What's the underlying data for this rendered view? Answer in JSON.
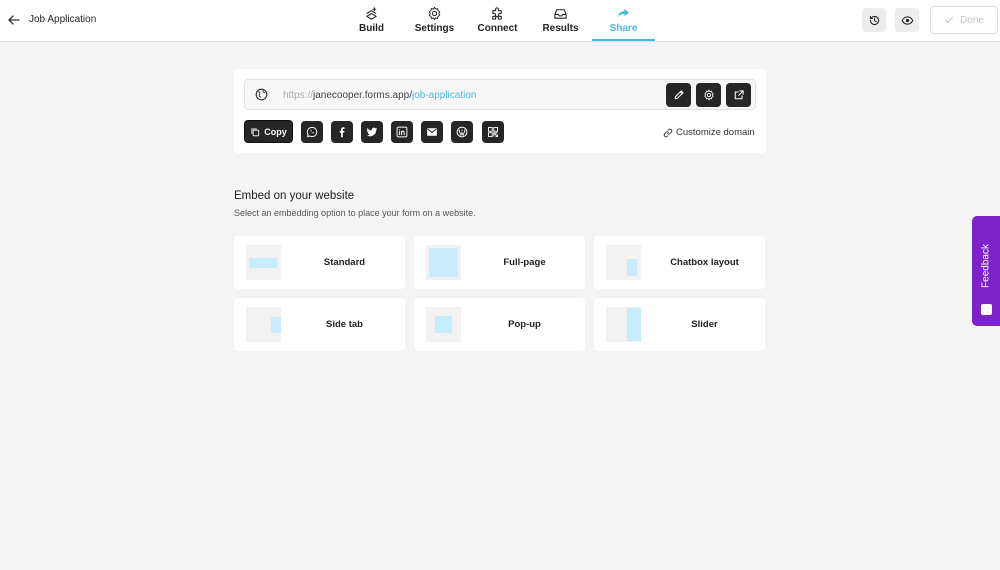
{
  "header": {
    "title": "Job Application",
    "tabs": [
      {
        "label": "Build",
        "icon": "build-icon",
        "active": false
      },
      {
        "label": "Settings",
        "icon": "gear-icon",
        "active": false
      },
      {
        "label": "Connect",
        "icon": "puzzle-icon",
        "active": false
      },
      {
        "label": "Results",
        "icon": "inbox-icon",
        "active": false
      },
      {
        "label": "Share",
        "icon": "share-arrow-icon",
        "active": true
      }
    ],
    "done_label": "Done"
  },
  "share": {
    "url_protocol": "https://",
    "url_host": "janecooper.forms.app/",
    "url_slug": "job-application",
    "copy_label": "Copy",
    "customize_domain_label": "Customize domain",
    "social_icons": [
      "whatsapp-icon",
      "facebook-icon",
      "twitter-icon",
      "linkedin-icon",
      "email-icon",
      "wordpress-icon",
      "qr-code-icon"
    ]
  },
  "embed": {
    "title": "Embed on your website",
    "subtitle": "Select an embedding option to place your form on a website.",
    "options": [
      {
        "label": "Standard"
      },
      {
        "label": "Full-page"
      },
      {
        "label": "Chatbox layout"
      },
      {
        "label": "Side tab"
      },
      {
        "label": "Pop-up"
      },
      {
        "label": "Slider"
      }
    ]
  },
  "feedback": {
    "label": "Feedback"
  },
  "colors": {
    "accent": "#4cb6e0",
    "dark_button": "#262626",
    "feedback": "#7b22c9",
    "thumb_fill": "#c8ecfb"
  }
}
